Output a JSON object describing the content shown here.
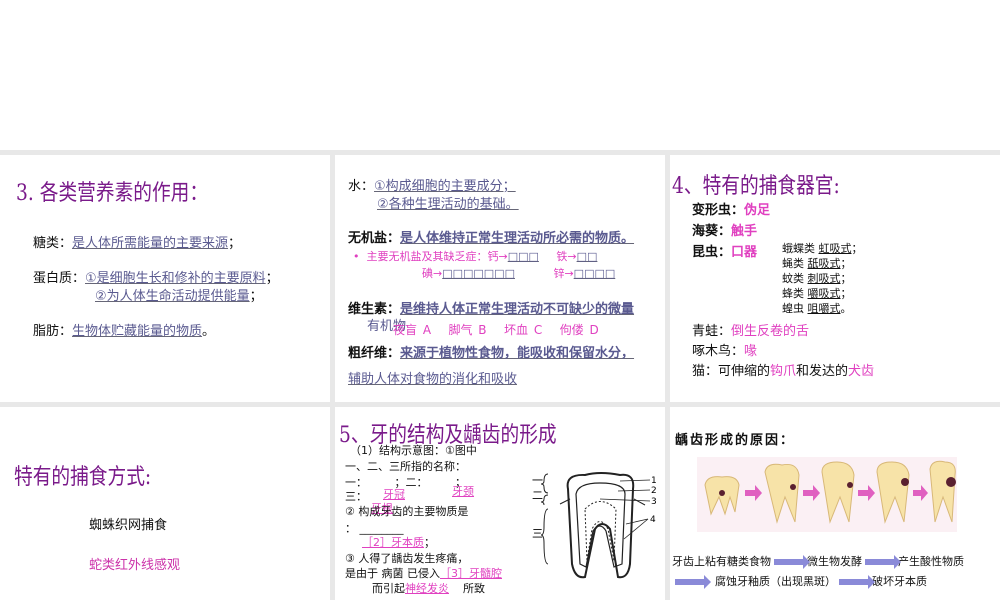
{
  "slides": [
    {
      "id": "prev"
    },
    {
      "title": "3. 各类营养素的作用：",
      "rows": [
        {
          "label": "糖类：",
          "text": "是人体所需能量的主要来源",
          "end": "；"
        },
        {
          "label": "蛋白质：",
          "text1": "①是细胞生长和修补的主要原料",
          "end1": "；",
          "text2": "②为人体生命活动提供能量",
          "end2": "；"
        },
        {
          "label": "脂肪：",
          "text": "生物体贮藏能量的物质",
          "end": "。"
        }
      ]
    },
    {
      "water_label": "水：",
      "water1": "①构成细胞的主要成分；",
      "water2": "②各种生理活动的基础。",
      "salt_label": "无机盐：",
      "salt_text": "是人体维持正常生理活动所必需的物质。",
      "salt_sub": "主要无机盐及其缺乏症：",
      "calcium": "钙→",
      "iron": "铁→",
      "iodine": "碘→",
      "zinc": "锌→",
      "vit_label": "维生素：",
      "vit_text": "是维持人体正常生理活动不可缺少的微量",
      "vit_text2": "有机物",
      "vit_items": [
        "夜盲 A",
        "脚气 B",
        "坏血 C",
        "佝偻 D"
      ],
      "fiber_label": "粗纤维：",
      "fiber_text": "来源于植物性食物，能吸收和保留水分，",
      "fiber_text2": "辅助人体对食物的消化和吸收"
    },
    {
      "title": "4、特有的捕食器官:",
      "items": [
        {
          "k": "变形虫：",
          "v": "伪足"
        },
        {
          "k": "海葵：",
          "v": "触手"
        },
        {
          "k": "昆虫：",
          "v": "口器"
        }
      ],
      "insects": [
        {
          "k": "蛾蝶类",
          "v": "虹吸式",
          "e": "；"
        },
        {
          "k": "蝇类",
          "v": "舐吸式",
          "e": "；"
        },
        {
          "k": "蚊类",
          "v": "刺吸式",
          "e": "；"
        },
        {
          "k": "蜂类",
          "v": "嚼吸式",
          "e": "；"
        },
        {
          "k": "蝗虫",
          "v": "咀嚼式",
          "e": "。"
        }
      ],
      "frog_k": "青蛙：",
      "frog_v": "倒生反卷的舌",
      "wp_k": "啄木鸟：",
      "wp_v": "喙",
      "cat_k": "猫：可伸缩的",
      "cat_v1": "钩爪",
      "cat_m": "和发达的",
      "cat_v2": "犬齿"
    },
    {
      "title": "特有的捕食方式:",
      "spider": "蜘蛛织网捕食",
      "snake": "蛇类红外线感观"
    },
    {
      "title": "5、牙的结构及龋齿的形成",
      "q1": "（1）结构示意图：①图中",
      "q1b": "一、二、三所指的名称：",
      "q1c": "一：　　　；二：　　　；",
      "q1d": "三：",
      "a_crown": "牙冠",
      "a_neck": "牙颈",
      "a_root": "牙根",
      "q2": "② 构成牙齿的主要物质是",
      "q2b": "：",
      "a2": "［2］牙本质",
      "a2e": "；",
      "q3": "③ 人得了龋齿发生疼痛，",
      "q3b": "是由于 病菌 已侵入",
      "a3": "［3］牙髓腔",
      "q3c": "而引起",
      "a3b": "神经发炎",
      "q3d": "所致",
      "diagram_labels": [
        "一",
        "二",
        "三",
        "1",
        "2",
        "3",
        "4"
      ]
    },
    {
      "title": "龋齿形成的原因：",
      "steps": [
        "牙齿上粘有糖类食物",
        "微生物发酵",
        "产生酸性物质",
        "腐蚀牙釉质（出现黑斑）",
        "破坏牙本质"
      ]
    }
  ]
}
